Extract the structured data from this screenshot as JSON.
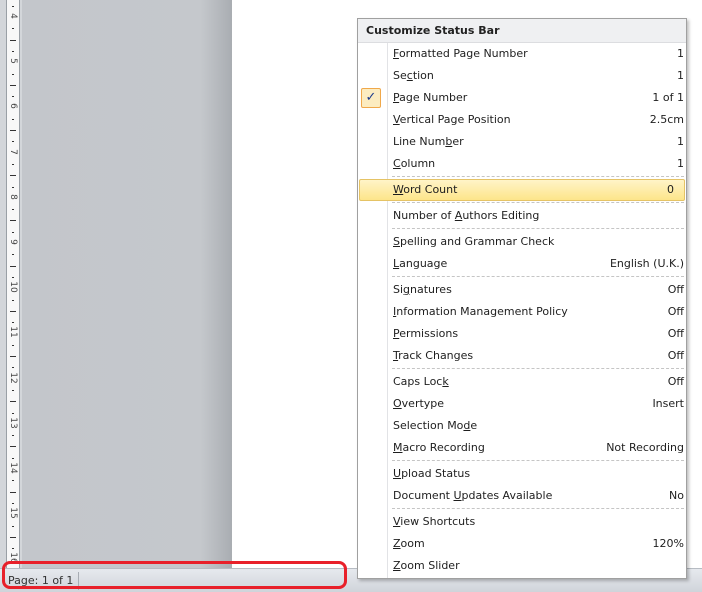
{
  "ruler": {
    "numbers": [
      "4",
      "5",
      "6",
      "7",
      "8",
      "9",
      "10",
      "11",
      "12",
      "13",
      "14",
      "15",
      "16"
    ]
  },
  "status_bar": {
    "page_label": "Page: 1 of 1"
  },
  "menu": {
    "title": "Customize Status Bar",
    "groups": [
      [
        {
          "label": "Formatted Page Number",
          "accel": 0,
          "value": "1"
        },
        {
          "label": "Section",
          "accel": 2,
          "value": "1"
        },
        {
          "label": "Page Number",
          "accel": 0,
          "value": "1 of 1",
          "checked": true
        },
        {
          "label": "Vertical Page Position",
          "accel": 0,
          "value": "2.5cm"
        },
        {
          "label": "Line Number",
          "accel": 8,
          "value": "1"
        },
        {
          "label": "Column",
          "accel": 0,
          "value": "1"
        }
      ],
      [
        {
          "label": "Word Count",
          "accel": 0,
          "value": "0",
          "highlighted": true
        }
      ],
      [
        {
          "label": "Number of Authors Editing",
          "accel": 10,
          "value": ""
        }
      ],
      [
        {
          "label": "Spelling and Grammar Check",
          "accel": 0,
          "value": ""
        },
        {
          "label": "Language",
          "accel": 0,
          "value": "English (U.K.)"
        }
      ],
      [
        {
          "label": "Signatures",
          "accel": 2,
          "value": "Off"
        },
        {
          "label": "Information Management Policy",
          "accel": 0,
          "value": "Off"
        },
        {
          "label": "Permissions",
          "accel": 0,
          "value": "Off"
        },
        {
          "label": "Track Changes",
          "accel": 0,
          "value": "Off"
        }
      ],
      [
        {
          "label": "Caps Lock",
          "accel": 8,
          "value": "Off"
        },
        {
          "label": "Overtype",
          "accel": 0,
          "value": "Insert"
        },
        {
          "label": "Selection Mode",
          "accel": 12,
          "value": ""
        },
        {
          "label": "Macro Recording",
          "accel": 0,
          "value": "Not Recording"
        }
      ],
      [
        {
          "label": "Upload Status",
          "accel": 0,
          "value": ""
        },
        {
          "label": "Document Updates Available",
          "accel": 9,
          "value": "No"
        }
      ],
      [
        {
          "label": "View Shortcuts",
          "accel": 0,
          "value": ""
        },
        {
          "label": "Zoom",
          "accel": 0,
          "value": "120%"
        },
        {
          "label": "Zoom Slider",
          "accel": 0,
          "value": ""
        }
      ]
    ]
  },
  "colors": {
    "highlight_annotation": "#e8202a",
    "check_accent": "#f0a84a"
  }
}
